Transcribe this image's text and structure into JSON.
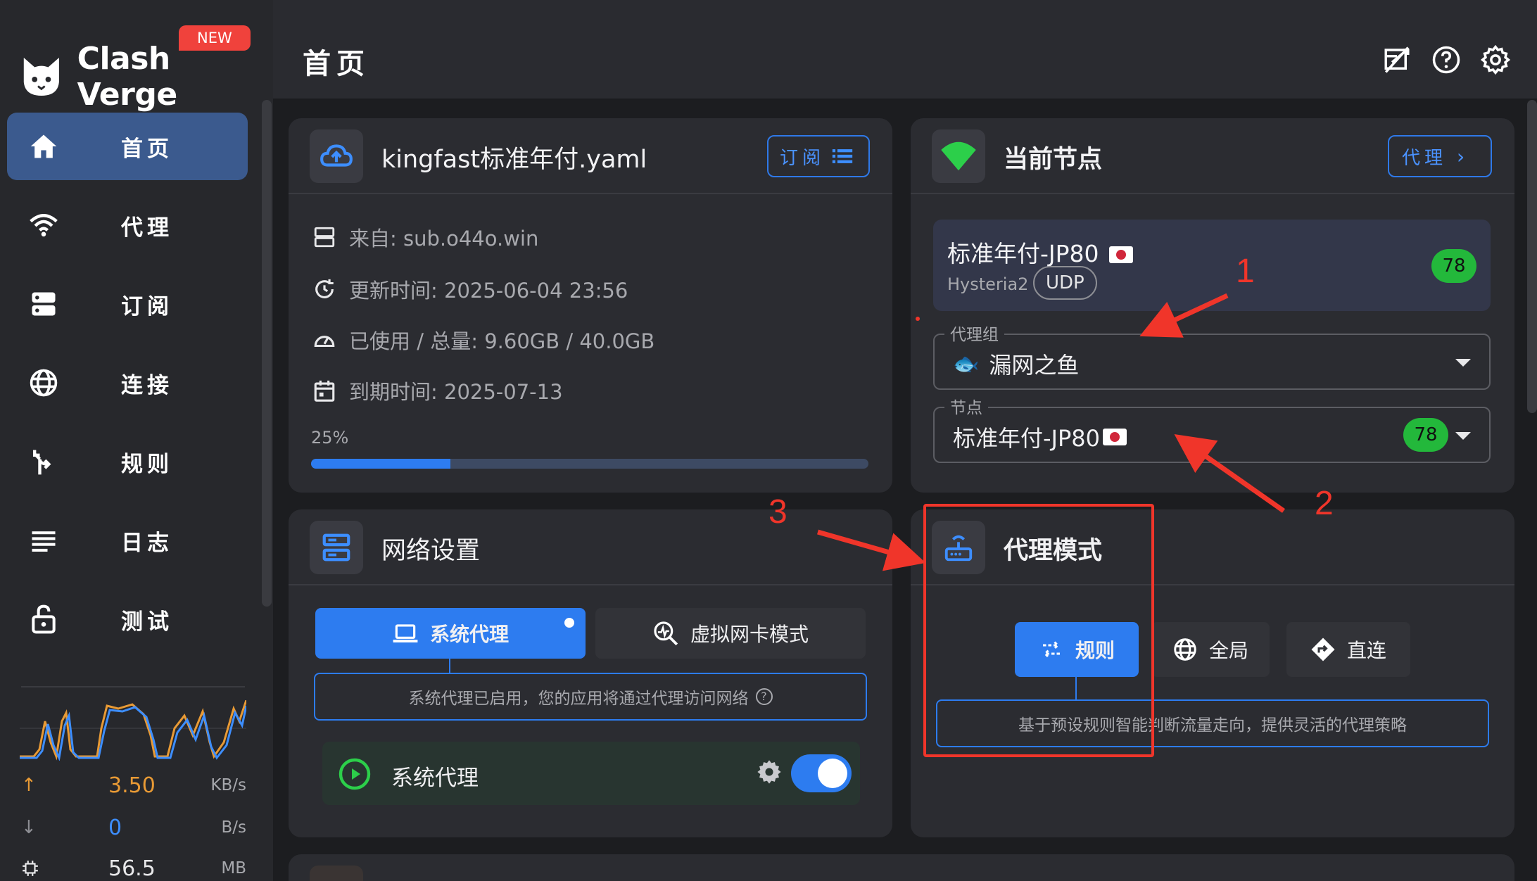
{
  "app": {
    "name": "Clash Verge",
    "new_badge": "NEW",
    "page_title": "首页"
  },
  "sidebar": {
    "items": [
      {
        "label": "首页",
        "icon": "home-icon",
        "active": true
      },
      {
        "label": "代理",
        "icon": "wifi-icon",
        "active": false
      },
      {
        "label": "订阅",
        "icon": "server-icon",
        "active": false
      },
      {
        "label": "连接",
        "icon": "globe-icon",
        "active": false
      },
      {
        "label": "规则",
        "icon": "fork-icon",
        "active": false
      },
      {
        "label": "日志",
        "icon": "list-icon",
        "active": false
      },
      {
        "label": "测试",
        "icon": "lock-icon",
        "active": false
      }
    ],
    "stats": {
      "upload": {
        "value": "3.50",
        "unit": "KB/s",
        "color": "#e89a35"
      },
      "download": {
        "value": "0",
        "unit": "B/s",
        "color": "#3d8eff"
      },
      "memory": {
        "value": "56.5",
        "unit": "MB"
      }
    }
  },
  "header": {
    "icons": [
      "tray-icon",
      "help-icon",
      "settings-icon"
    ]
  },
  "subscription": {
    "title": "kingfast标准年付.yaml",
    "button_label": "订阅",
    "source": "来自: sub.o44o.win",
    "updated": "更新时间: 2025-06-04 23:56",
    "usage": "已使用 / 总量: 9.60GB / 40.0GB",
    "expire": "到期时间: 2025-07-13",
    "progress_label": "25%",
    "progress_value": 0.25
  },
  "current_node": {
    "title": "当前节点",
    "button_label": "代理",
    "node_name": "标准年付-JP80",
    "protocol": "Hysteria2",
    "udp_badge": "UDP",
    "latency": "78",
    "group_label": "代理组",
    "group_value": "漏网之鱼",
    "node_label": "节点",
    "node_value": "标准年付-JP80",
    "node_latency": "78"
  },
  "network": {
    "title": "网络设置",
    "tab_system": "系统代理",
    "tab_tun": "虚拟网卡模式",
    "hint": "系统代理已启用，您的应用将通过代理访问网络",
    "row_label": "系统代理",
    "enabled": true
  },
  "proxy_mode": {
    "title": "代理模式",
    "modes": [
      "规则",
      "全局",
      "直连"
    ],
    "active_mode": "规则",
    "hint": "基于预设规则智能判断流量走向，提供灵活的代理策略"
  },
  "annotations": {
    "n1": "1",
    "n2": "2",
    "n3": "3",
    "color": "#f0352a"
  }
}
